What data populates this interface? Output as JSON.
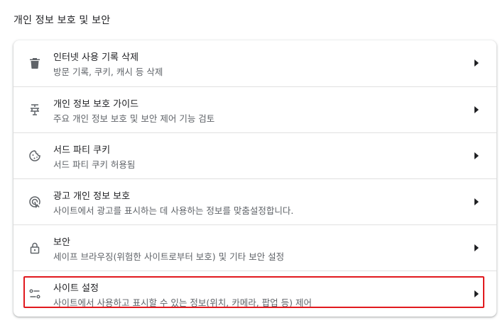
{
  "section": {
    "title": "개인 정보 보호 및 보안"
  },
  "rows": [
    {
      "label": "인터넷 사용 기록 삭제",
      "sublabel": "방문 기록, 쿠키, 캐시 등 삭제",
      "icon": "trash-icon"
    },
    {
      "label": "개인 정보 보호 가이드",
      "sublabel": "주요 개인 정보 보호 및 보안 제어 기능 검토",
      "icon": "privacy-guide-icon"
    },
    {
      "label": "서드 파티 쿠키",
      "sublabel": "서드 파티 쿠키 허용됨",
      "icon": "cookie-icon"
    },
    {
      "label": "광고 개인 정보 보호",
      "sublabel": "사이트에서 광고를 표시하는 데 사용하는 정보를 맞춤설정합니다.",
      "icon": "ad-privacy-icon"
    },
    {
      "label": "보안",
      "sublabel": "세이프 브라우징(위험한 사이트로부터 보호) 및 기타 보안 설정",
      "icon": "lock-icon"
    },
    {
      "label": "사이트 설정",
      "sublabel": "사이트에서 사용하고 표시할 수 있는 정보(위치, 카메라, 팝업 등) 제어",
      "icon": "tune-icon"
    }
  ],
  "colors": {
    "highlight": "#e1191e",
    "text": "#202124",
    "secondary": "#5f6368"
  }
}
